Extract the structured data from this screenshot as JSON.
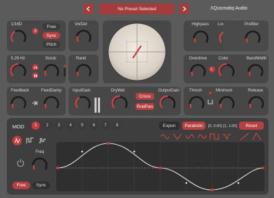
{
  "header": {
    "preset": "No Preset Selected",
    "brand": "ΛQusmatiq Audio",
    "prev_icon": "chevron-left-icon",
    "next_icon": "chevron-right-icon"
  },
  "delay": {
    "time_value": "1/16D",
    "badge": "3",
    "free_label": "Free",
    "sync_label": "Sync",
    "pitch_label": "Pitch",
    "vordel_label": "VorDel",
    "rate_value": "5.29 Hz",
    "scrub_label": "Scrub",
    "rand_label": "Rand",
    "feedback_label": "Feedback",
    "feeddamp_label": "FeedDamp"
  },
  "mix": {
    "input_label": "InputGain",
    "drywet_label": "DryWet",
    "cross_label": "Cross",
    "rndpan_label": "RndPan",
    "output_label": "OutputGain"
  },
  "filter": {
    "highpass_label": "Highpass",
    "lowpass_label": "Lowpass",
    "prefilter_label": "Prefilter",
    "overdrive_label": "Overdrive",
    "color_label": "Color",
    "bandwidth_label": "BandWidth",
    "l_badge": "L",
    "thresh_label": "Thresh",
    "minimum_label": "Minimum",
    "release_label": "Release"
  },
  "mod": {
    "title": "MOD",
    "slots": [
      "1",
      "2",
      "3",
      "4",
      "5",
      "6",
      "7",
      "8"
    ],
    "active_slot": 0,
    "expon_label": "Expon",
    "parabolic_label": "Parabolic",
    "range1": "[0, 0.00]",
    "range2": "[1, 1.00]",
    "reset_label": "Reset",
    "freq_label": "Freq",
    "free_label": "Free",
    "sync_label": "Sync"
  },
  "colors": {
    "accent": "#c43c3c",
    "panel": "#474747",
    "bg": "#5b5b5b"
  }
}
